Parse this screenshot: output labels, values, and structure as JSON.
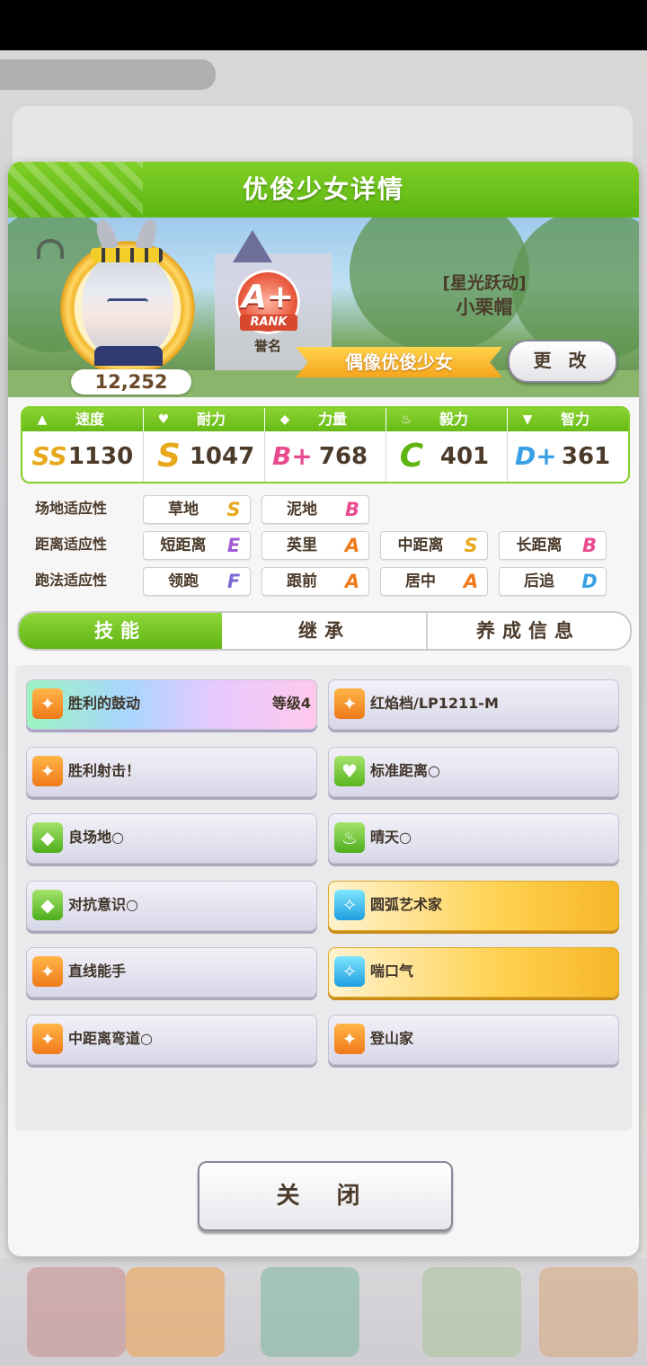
{
  "panel": {
    "title": "优俊少女详情"
  },
  "profile": {
    "fans": "12,252",
    "rank": {
      "letter": "A+",
      "ribbon": "RANK",
      "caption": "誉名"
    },
    "title_line1": "[星光跃动]",
    "title_line2": "小栗帽",
    "role": "偶像优俊少女",
    "change_button": "更 改"
  },
  "stats": [
    {
      "label": "速度",
      "icon": "shoe-icon",
      "grade": "SS",
      "value": "1130",
      "color": "#e7a81b"
    },
    {
      "label": "耐力",
      "icon": "heart-icon",
      "grade": "S",
      "value": "1047",
      "color": "#e7a81b"
    },
    {
      "label": "力量",
      "icon": "muscle-icon",
      "grade": "B+",
      "value": "768",
      "color": "#e84b8f"
    },
    {
      "label": "毅力",
      "icon": "flame-icon",
      "grade": "C",
      "value": "401",
      "color": "#5db510"
    },
    {
      "label": "智力",
      "icon": "graduation-cap-icon",
      "grade": "D+",
      "value": "361",
      "color": "#3aa0e5"
    }
  ],
  "aptitude": {
    "rows": [
      {
        "label": "场地适应性",
        "items": [
          {
            "name": "草地",
            "grade": "S"
          },
          {
            "name": "泥地",
            "grade": "B"
          }
        ]
      },
      {
        "label": "距离适应性",
        "items": [
          {
            "name": "短距离",
            "grade": "E"
          },
          {
            "name": "英里",
            "grade": "A"
          },
          {
            "name": "中距离",
            "grade": "S"
          },
          {
            "name": "长距离",
            "grade": "B"
          }
        ]
      },
      {
        "label": "跑法适应性",
        "items": [
          {
            "name": "领跑",
            "grade": "F"
          },
          {
            "name": "跟前",
            "grade": "A"
          },
          {
            "name": "居中",
            "grade": "A"
          },
          {
            "name": "后追",
            "grade": "D"
          }
        ]
      }
    ]
  },
  "tabs": [
    {
      "label": "技能",
      "active": true
    },
    {
      "label": "继承",
      "active": false
    },
    {
      "label": "养成信息",
      "active": false
    }
  ],
  "skills": [
    {
      "name": "胜利的鼓动",
      "level": "等级4",
      "style": "rainbow",
      "icon": "runner-icon"
    },
    {
      "name": "红焰档/LP1211-M",
      "level": "",
      "style": "normal",
      "icon": "runner-icon"
    },
    {
      "name": "胜利射击！",
      "level": "",
      "style": "normal",
      "icon": "runner-icon"
    },
    {
      "name": "标准距离○",
      "level": "",
      "style": "normal",
      "icon": "heart-icon"
    },
    {
      "name": "良场地○",
      "level": "",
      "style": "normal",
      "icon": "muscle-icon"
    },
    {
      "name": "晴天○",
      "level": "",
      "style": "normal",
      "icon": "flame-icon"
    },
    {
      "name": "对抗意识○",
      "level": "",
      "style": "normal",
      "icon": "muscle-icon"
    },
    {
      "name": "圆弧艺术家",
      "level": "",
      "style": "gold",
      "icon": "sparkle-icon"
    },
    {
      "name": "直线能手",
      "level": "",
      "style": "normal",
      "icon": "runner-icon"
    },
    {
      "name": "喘口气",
      "level": "",
      "style": "gold",
      "icon": "sparkle-icon"
    },
    {
      "name": "中距离弯道○",
      "level": "",
      "style": "normal",
      "icon": "runner-icon"
    },
    {
      "name": "登山家",
      "level": "",
      "style": "normal",
      "icon": "runner-icon"
    }
  ],
  "close_button": "关 闭"
}
